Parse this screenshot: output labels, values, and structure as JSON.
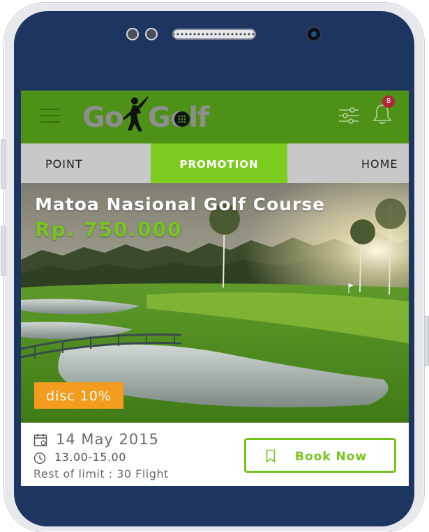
{
  "app": {
    "logo_prefix": "Go",
    "logo_suffix": "Golf",
    "notification_count": "8"
  },
  "tabs": [
    {
      "label": "POINT",
      "active": false
    },
    {
      "label": "PROMOTION",
      "active": true
    },
    {
      "label": "HOME",
      "active": false
    }
  ],
  "promo": {
    "title": "Matoa Nasional Golf Course",
    "price": "Rp. 750.000",
    "discount": "disc 10%",
    "date": "14 May 2015",
    "time": "13.00-15.00",
    "limit": "Rest of limit : 30 Flight",
    "book_label": "Book Now"
  },
  "icons": [
    "menu-icon",
    "golfer-icon",
    "golf-ball-icon",
    "filter-icon",
    "bell-icon",
    "calendar-icon",
    "clock-icon",
    "bookmark-icon"
  ],
  "colors": {
    "phone_frame": "#1c3561",
    "header_green": "#4d9117",
    "accent_green": "#7ccc20",
    "price_green": "#76c51d",
    "discount_orange": "#f39c1d",
    "badge_red": "#b3263a",
    "tab_gray": "#c8c8c8"
  }
}
